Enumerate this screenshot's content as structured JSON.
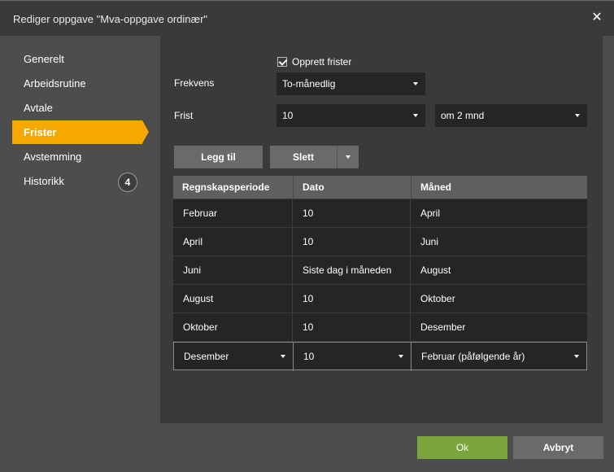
{
  "window": {
    "title": "Rediger oppgave \"Mva-oppgave ordinær\"",
    "close_icon": "close-icon"
  },
  "sidebar": {
    "items": [
      {
        "label": "Generelt"
      },
      {
        "label": "Arbeidsrutine"
      },
      {
        "label": "Avtale"
      },
      {
        "label": "Frister",
        "active": true
      },
      {
        "label": "Avstemming"
      },
      {
        "label": "Historikk",
        "badge": "4"
      }
    ]
  },
  "form": {
    "create_deadlines": {
      "label": "Opprett frister",
      "checked": true
    },
    "frequency": {
      "label": "Frekvens",
      "value": "To-månedlig"
    },
    "deadline": {
      "label": "Frist",
      "value": "10",
      "offset_value": "om 2 mnd"
    }
  },
  "toolbar": {
    "add_label": "Legg til",
    "delete_label": "Slett"
  },
  "table": {
    "headers": [
      "Regnskapsperiode",
      "Dato",
      "Måned"
    ],
    "rows": [
      [
        "Februar",
        "10",
        "April"
      ],
      [
        "April",
        "10",
        "Juni"
      ],
      [
        "Juni",
        "Siste dag i måneden",
        "August"
      ],
      [
        "August",
        "10",
        "Oktober"
      ],
      [
        "Oktober",
        "10",
        "Desember"
      ],
      [
        "Desember",
        "10",
        "Februar (påfølgende år)"
      ]
    ]
  },
  "footer": {
    "ok_label": "Ok",
    "cancel_label": "Avbryt"
  },
  "colors": {
    "accent": "#f5a800",
    "ok": "#7aa43c",
    "panel": "#3a3a3a",
    "background": "#4d4d4d"
  }
}
